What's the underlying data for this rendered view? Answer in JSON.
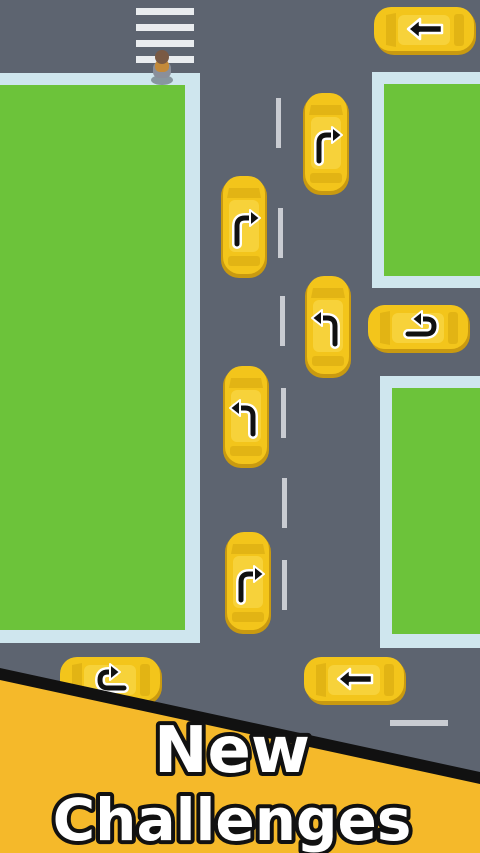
{
  "banner": {
    "line1": "New",
    "line2": "Challenges",
    "color": "#f5b92a",
    "text_color": "#ffffff",
    "outline_color": "#111111"
  },
  "colors": {
    "road": "#5d6470",
    "grass": "#6cc33a",
    "curb": "#cfe6ee",
    "lane_mark": "#c9ccd2",
    "taxi_body": "#f3c51b",
    "taxi_shadow": "#c99a10"
  },
  "cars": [
    {
      "id": "car-1",
      "arrow": "left-arrow-icon"
    },
    {
      "id": "car-2",
      "arrow": "turn-right-arrow-icon"
    },
    {
      "id": "car-3",
      "arrow": "turn-right-arrow-icon"
    },
    {
      "id": "car-4",
      "arrow": "turn-left-arrow-icon"
    },
    {
      "id": "car-5",
      "arrow": "u-turn-arrow-icon"
    },
    {
      "id": "car-6",
      "arrow": "turn-left-arrow-icon"
    },
    {
      "id": "car-7",
      "arrow": "turn-right-arrow-icon"
    },
    {
      "id": "car-8",
      "arrow": "u-turn-arrow-icon"
    },
    {
      "id": "car-9",
      "arrow": "left-arrow-icon"
    }
  ]
}
